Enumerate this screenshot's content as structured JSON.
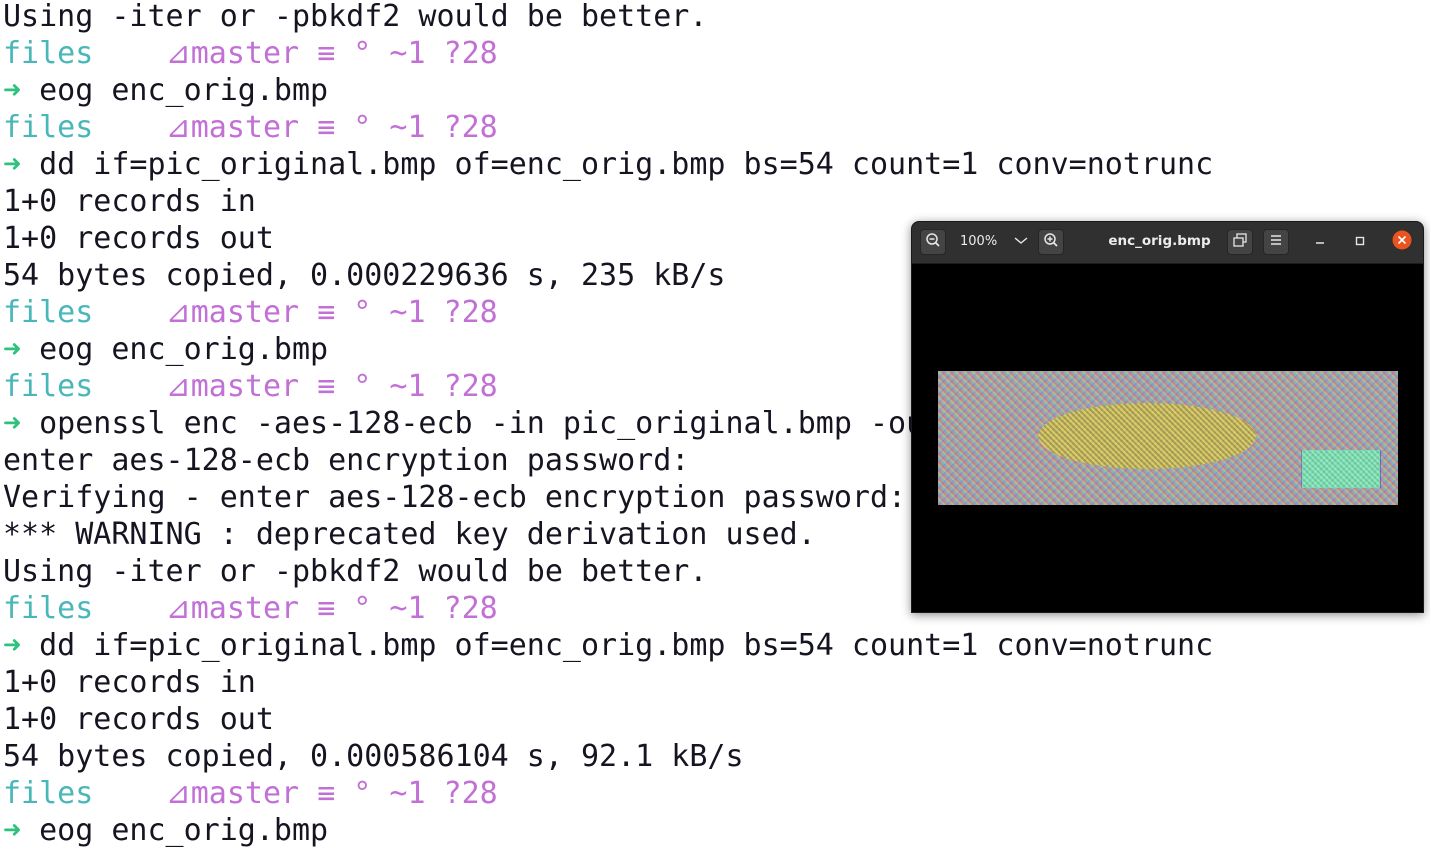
{
  "colors": {
    "terminal_background": "#ffffff",
    "terminal_text": "#171421",
    "prompt_dir": "#49b7ba",
    "prompt_git": "#c26fd6",
    "prompt_arrow": "#2ec27e",
    "viewer_headerbar": "#303030",
    "viewer_close": "#e95420"
  },
  "prompt": {
    "dir": "files",
    "git": "⊿master ≡ ° ~1 ?28",
    "arrow": "➜"
  },
  "terminal": {
    "line_01": "Using -iter or -pbkdf2 would be better.",
    "cmd_01": "eog enc_orig.bmp",
    "cmd_02": "dd if=pic_original.bmp of=enc_orig.bmp bs=54 count=1 conv=notrunc",
    "line_02": "1+0 records in",
    "line_03": "1+0 records out",
    "line_04": "54 bytes copied, 0.000229636 s, 235 kB/s",
    "cmd_03": "eog enc_orig.bmp",
    "cmd_04": "openssl enc -aes-128-ecb -in pic_original.bmp -ou",
    "line_05": "enter aes-128-ecb encryption password:",
    "line_06": "Verifying - enter aes-128-ecb encryption password:",
    "line_07": "*** WARNING : deprecated key derivation used.",
    "line_08": "Using -iter or -pbkdf2 would be better.",
    "cmd_05": "dd if=pic_original.bmp of=enc_orig.bmp bs=54 count=1 conv=notrunc",
    "line_09": "1+0 records in",
    "line_10": "1+0 records out",
    "line_11": "54 bytes copied, 0.000586104 s, 92.1 kB/s",
    "cmd_06": "eog enc_orig.bmp"
  },
  "viewer": {
    "title": "enc_orig.bmp",
    "zoom_level": "100%",
    "icons": {
      "zoom_out": "zoom-out-icon",
      "zoom_dropdown": "chevron-down-icon",
      "zoom_in": "zoom-in-icon",
      "fullscreen": "fullscreen-icon",
      "menu": "hamburger-menu-icon",
      "minimize": "minimize-icon",
      "maximize": "maximize-icon",
      "close": "close-icon"
    }
  }
}
